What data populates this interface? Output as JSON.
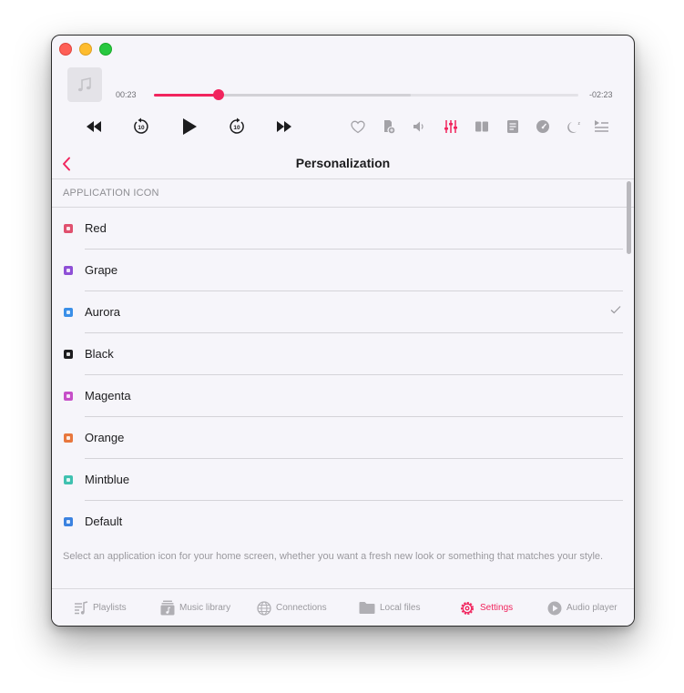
{
  "window": {
    "title": ""
  },
  "player": {
    "elapsed": "00:23",
    "remaining": "-02:23",
    "progress_fraction": 0.152,
    "buffered_fraction": 0.605,
    "artwork_icon": "music-note-icon",
    "controls": [
      {
        "name": "rewind-icon"
      },
      {
        "name": "skip-back-10-icon"
      },
      {
        "name": "play-icon"
      },
      {
        "name": "skip-forward-10-icon"
      },
      {
        "name": "fast-forward-icon"
      }
    ],
    "toolbar_icons": [
      "heart-icon",
      "add-to-playlist-icon",
      "volume-icon",
      "equalizer-icon",
      "split-view-icon",
      "lyrics-icon",
      "speed-icon",
      "sleep-timer-icon",
      "queue-icon"
    ],
    "accent_color": "#f1245d"
  },
  "nav": {
    "title": "Personalization",
    "back_icon": "chevron-left-icon"
  },
  "section": {
    "header": "APPLICATION ICON"
  },
  "icons": [
    {
      "label": "Red",
      "color": "#e0506e",
      "selected": false
    },
    {
      "label": "Grape",
      "color": "#8e4fd6",
      "selected": false
    },
    {
      "label": "Aurora",
      "color": "#3a8fe8",
      "selected": true
    },
    {
      "label": "Black",
      "color": "#1c1c1e",
      "selected": false
    },
    {
      "label": "Magenta",
      "color": "#c64fc8",
      "selected": false
    },
    {
      "label": "Orange",
      "color": "#e8773d",
      "selected": false
    },
    {
      "label": "Mintblue",
      "color": "#3fc1b0",
      "selected": false
    },
    {
      "label": "Default",
      "color": "#3b82e0",
      "selected": false
    }
  ],
  "footer": {
    "note": "Select an application icon for your home screen, whether you want a fresh new look or something that matches your style."
  },
  "tabs": [
    {
      "label": "Playlists",
      "icon": "playlists-icon",
      "active": false
    },
    {
      "label": "Music library",
      "icon": "music-library-icon",
      "active": false
    },
    {
      "label": "Connections",
      "icon": "globe-icon",
      "active": false
    },
    {
      "label": "Local files",
      "icon": "folder-icon",
      "active": false
    },
    {
      "label": "Settings",
      "icon": "gear-icon",
      "active": true
    },
    {
      "label": "Audio player",
      "icon": "play-circle-icon",
      "active": false
    }
  ]
}
